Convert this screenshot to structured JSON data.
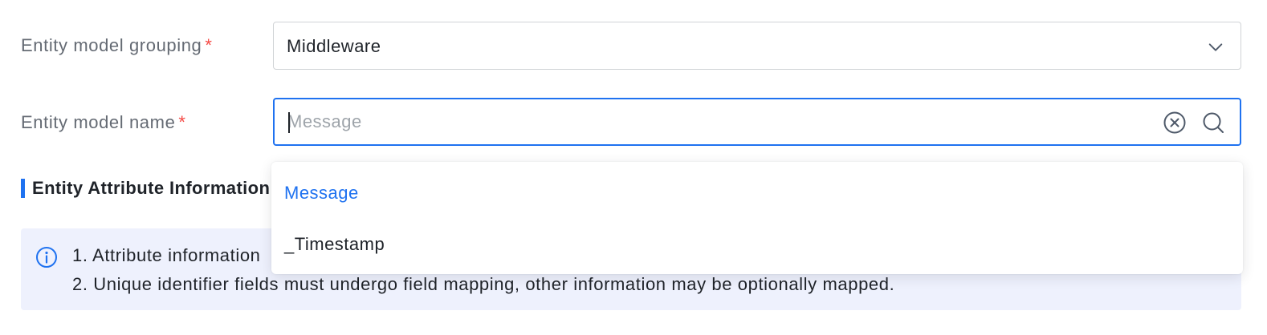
{
  "form": {
    "grouping": {
      "label": "Entity model grouping",
      "required_mark": "*",
      "value": "Middleware"
    },
    "name": {
      "label": "Entity model name",
      "required_mark": "*",
      "placeholder": "Message",
      "value": ""
    }
  },
  "dropdown": {
    "options": [
      {
        "label": "Message",
        "selected": true
      },
      {
        "label": "_Timestamp",
        "selected": false
      }
    ]
  },
  "section": {
    "title": "Entity Attribute Information"
  },
  "info": {
    "lines": [
      "1. Attribute information",
      "2. Unique identifier fields must undergo field mapping, other information may be optionally mapped."
    ]
  },
  "icons": {
    "chevron": "chevron-down-icon",
    "clear": "clear-circle-icon",
    "search": "search-icon",
    "info": "info-circle-icon"
  },
  "colors": {
    "accent": "#1f72f0",
    "required": "#f54a45",
    "info_background": "#eef1fd"
  }
}
